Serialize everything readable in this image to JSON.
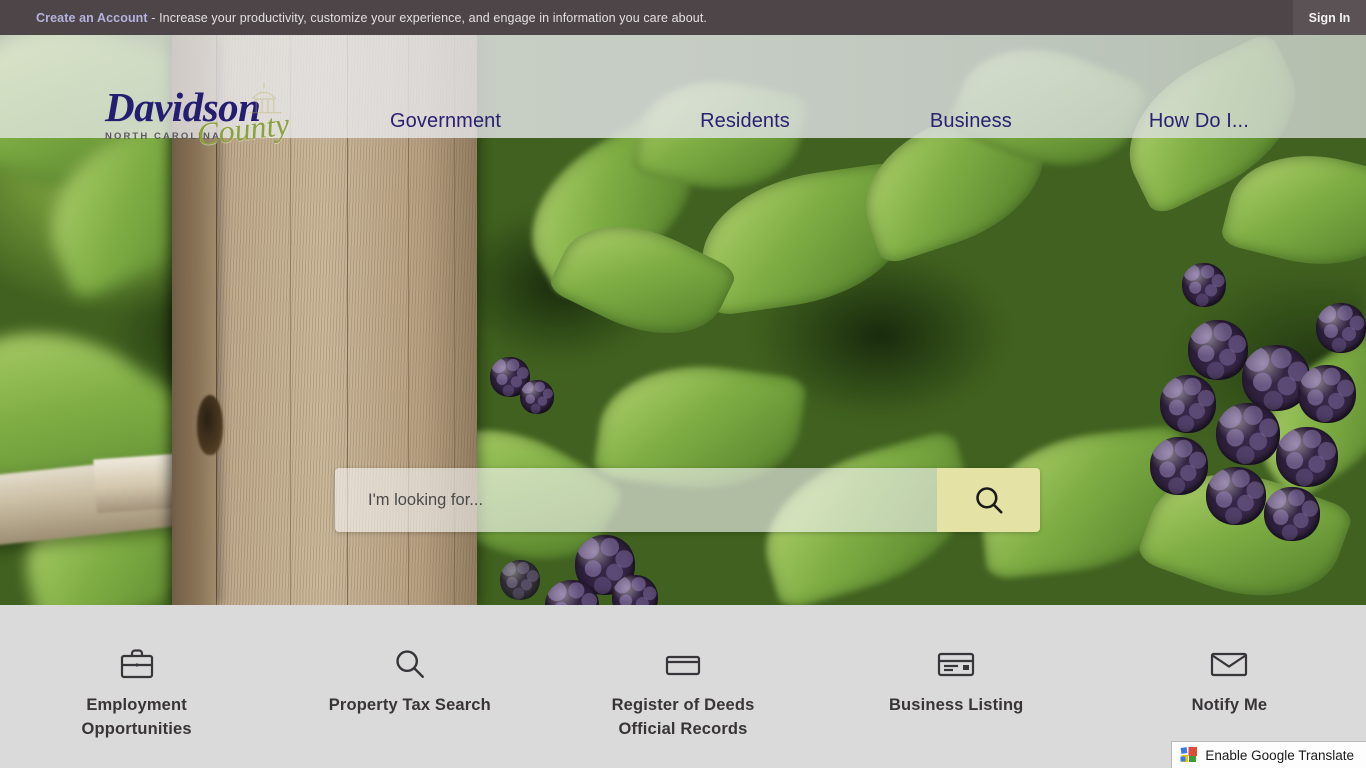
{
  "topbar": {
    "account_link": "Create an Account",
    "separator": " - ",
    "message": "Increase your productivity, customize your experience, and engage in information you care about.",
    "signin_label": "Sign In",
    "bg_color": "#4e4549",
    "link_color": "#b4b3dd"
  },
  "header": {
    "logo": {
      "word": "Davidson",
      "state": "NORTH CAROLINA",
      "county": "County",
      "word_color": "#241d72",
      "county_color": "#8aa23c"
    },
    "nav": [
      {
        "label": "Government"
      },
      {
        "label": "Residents"
      },
      {
        "label": "Business"
      },
      {
        "label": "How Do I..."
      }
    ],
    "nav_color": "#2a2170"
  },
  "hero": {
    "search": {
      "placeholder": "I'm looking for...",
      "value": "",
      "button_icon": "search-icon",
      "button_color": "#e4e2a4"
    }
  },
  "quicklinks": {
    "bg_color": "#dadada",
    "items": [
      {
        "label": "Employment\nOpportunities",
        "line1": "Employment",
        "line2": "Opportunities",
        "icon": "briefcase-icon"
      },
      {
        "label": "Property Tax Search",
        "line1": "Property Tax Search",
        "line2": "",
        "icon": "search-icon"
      },
      {
        "label": "Register of Deeds\nOfficial Records",
        "line1": "Register of Deeds",
        "line2": "Official Records",
        "icon": "folder-icon"
      },
      {
        "label": "Business Listing",
        "line1": "Business Listing",
        "line2": "",
        "icon": "id-card-icon"
      },
      {
        "label": "Notify Me",
        "line1": "Notify Me",
        "line2": "",
        "icon": "envelope-icon"
      }
    ]
  },
  "google_translate": {
    "label": "Enable Google Translate",
    "icon": "google-logo-icon"
  }
}
